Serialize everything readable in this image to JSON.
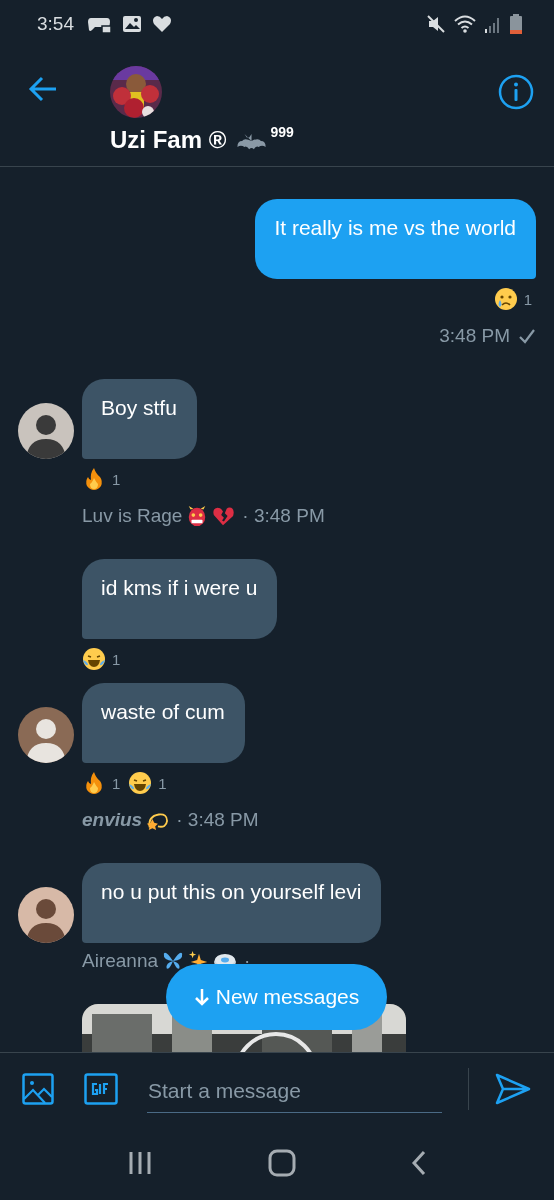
{
  "status_bar": {
    "time": "3:54"
  },
  "header": {
    "title": "Uzi Fam ®",
    "title_badges": [
      {
        "kind": "bat"
      }
    ],
    "title_sup": "999"
  },
  "messages": [
    {
      "kind": "sent",
      "text": "It really is me vs the world",
      "reactions": [
        {
          "kind": "cry",
          "count": "1"
        }
      ],
      "time": "3:48 PM",
      "delivered": true
    },
    {
      "kind": "received",
      "avatar": true,
      "text": "Boy stfu",
      "reactions": [
        {
          "kind": "fire",
          "count": "1"
        }
      ],
      "sender": "Luv is Rage",
      "sender_bold_italic": false,
      "sender_badges": [
        {
          "kind": "ogre"
        },
        {
          "kind": "broken-heart"
        }
      ],
      "time": "· 3:48 PM"
    },
    {
      "kind": "received",
      "avatar": false,
      "text": "id kms if i were u",
      "reactions": [
        {
          "kind": "joy",
          "count": "1"
        }
      ]
    },
    {
      "kind": "received",
      "avatar": true,
      "text": "waste of cum",
      "reactions": [
        {
          "kind": "fire",
          "count": "1"
        },
        {
          "kind": "joy",
          "count": "1"
        }
      ],
      "sender": "envius",
      "sender_bold_italic": true,
      "sender_badges": [
        {
          "kind": "dizzy"
        }
      ],
      "time": "· 3:48 PM"
    },
    {
      "kind": "received",
      "avatar": true,
      "text": "no u put this on yourself levi",
      "sender": "Aireanna",
      "sender_bold_italic": false,
      "sender_badges": [
        {
          "kind": "butterfly"
        },
        {
          "kind": "sparkles"
        },
        {
          "kind": "disc"
        }
      ],
      "time": "·"
    },
    {
      "kind": "media",
      "avatar": false
    }
  ],
  "new_messages_button": {
    "label": "New messages"
  },
  "composer": {
    "placeholder": "Start a message"
  }
}
